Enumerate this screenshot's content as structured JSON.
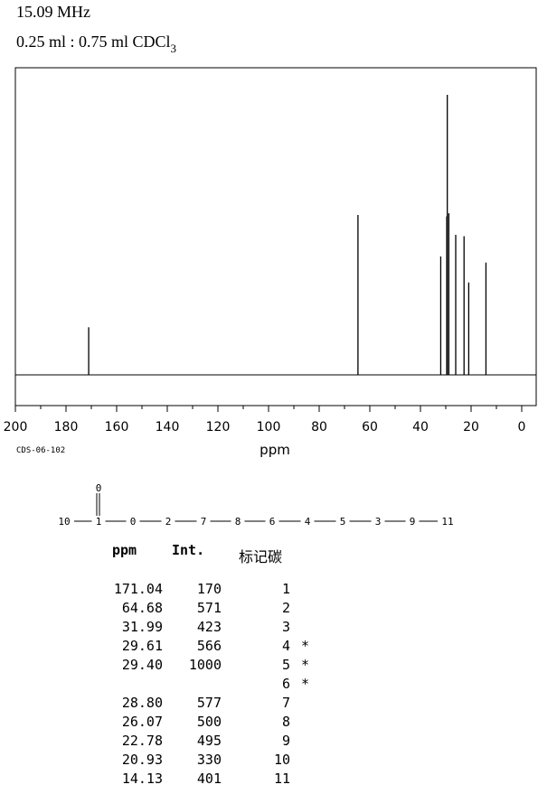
{
  "header": {
    "frequency": "15.09 MHz",
    "solvent_prefix": "0.25 ml : 0.75 ml CDCl",
    "solvent_sub": "3"
  },
  "chart_data": {
    "type": "line",
    "title": "",
    "xlabel": "ppm",
    "ylabel": "",
    "xlim": [
      200,
      0
    ],
    "x_reversed": true,
    "xticks": [
      200,
      180,
      160,
      140,
      120,
      100,
      80,
      60,
      40,
      20,
      0
    ],
    "peaks": [
      {
        "ppm": 171.04,
        "intensity": 170
      },
      {
        "ppm": 64.68,
        "intensity": 571
      },
      {
        "ppm": 31.99,
        "intensity": 423
      },
      {
        "ppm": 29.61,
        "intensity": 566
      },
      {
        "ppm": 29.4,
        "intensity": 1000
      },
      {
        "ppm": 28.8,
        "intensity": 577
      },
      {
        "ppm": 26.07,
        "intensity": 500
      },
      {
        "ppm": 22.78,
        "intensity": 495
      },
      {
        "ppm": 20.93,
        "intensity": 330
      },
      {
        "ppm": 14.13,
        "intensity": 401
      }
    ]
  },
  "spectrum_code": "CDS-06-102",
  "structure": {
    "atoms": [
      "10",
      "1",
      "0",
      "2",
      "7",
      "8",
      "6",
      "4",
      "5",
      "3",
      "9",
      "11"
    ],
    "carbonyl_label": "0"
  },
  "table": {
    "headers": {
      "ppm": "ppm",
      "intensity": "Int.",
      "carbon": "标记碳"
    },
    "rows": [
      {
        "ppm": "171.04",
        "int": "170",
        "carbon": "1",
        "mark": ""
      },
      {
        "ppm": "64.68",
        "int": "571",
        "carbon": "2",
        "mark": ""
      },
      {
        "ppm": "31.99",
        "int": "423",
        "carbon": "3",
        "mark": ""
      },
      {
        "ppm": "29.61",
        "int": "566",
        "carbon": "4",
        "mark": "*"
      },
      {
        "ppm": "29.40",
        "int": "1000",
        "carbon": "5",
        "mark": "*"
      },
      {
        "ppm": "",
        "int": "",
        "carbon": "6",
        "mark": "*"
      },
      {
        "ppm": "28.80",
        "int": "577",
        "carbon": "7",
        "mark": ""
      },
      {
        "ppm": "26.07",
        "int": "500",
        "carbon": "8",
        "mark": ""
      },
      {
        "ppm": "22.78",
        "int": "495",
        "carbon": "9",
        "mark": ""
      },
      {
        "ppm": "20.93",
        "int": "330",
        "carbon": "10",
        "mark": ""
      },
      {
        "ppm": "14.13",
        "int": "401",
        "carbon": "11",
        "mark": ""
      }
    ]
  }
}
